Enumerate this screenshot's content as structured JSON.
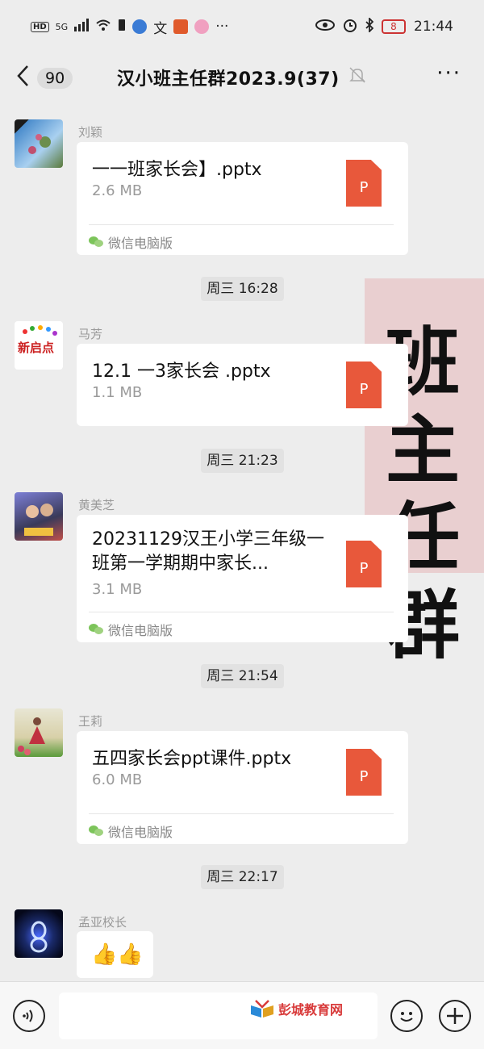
{
  "status_bar": {
    "network": "5G",
    "hd": "HD",
    "wen": "文",
    "battery": "8",
    "time": "21:44",
    "more": "···"
  },
  "header": {
    "back_icon": "chevron-left-icon",
    "unread_count": "90",
    "title": "汉小班主任群2023.9(37)",
    "mute_icon": "bell-off-icon",
    "more": "···"
  },
  "overlay_text": "班主任群",
  "messages": [
    {
      "sender": "刘颖",
      "file_name": "一一班家长会】.pptx",
      "file_size": "2.6 MB",
      "file_icon": "P",
      "source": "微信电脑版"
    },
    {
      "time": "周三 16:28"
    },
    {
      "sender": "马芳",
      "file_name": "12.1 一3家长会 .pptx",
      "file_size": "1.1 MB",
      "file_icon": "P",
      "avatar_text": "新启点"
    },
    {
      "time": "周三 21:23"
    },
    {
      "sender": "黄美芝",
      "file_name": "20231129汉王小学三年级一班第一学期期中家长...",
      "file_size": "3.1 MB",
      "file_icon": "P",
      "source": "微信电脑版"
    },
    {
      "time": "周三 21:54"
    },
    {
      "sender": "王莉",
      "file_name": "五四家长会ppt课件.pptx",
      "file_size": "6.0 MB",
      "file_icon": "P",
      "source": "微信电脑版"
    },
    {
      "time": "周三 22:17"
    },
    {
      "sender": "孟亚校长",
      "content": "👍👍"
    }
  ],
  "toolbar": {
    "watermark": "彭城教育网",
    "voice_icon": "voice-icon",
    "emoji_icon": "emoji-icon",
    "plus_icon": "plus-icon"
  }
}
